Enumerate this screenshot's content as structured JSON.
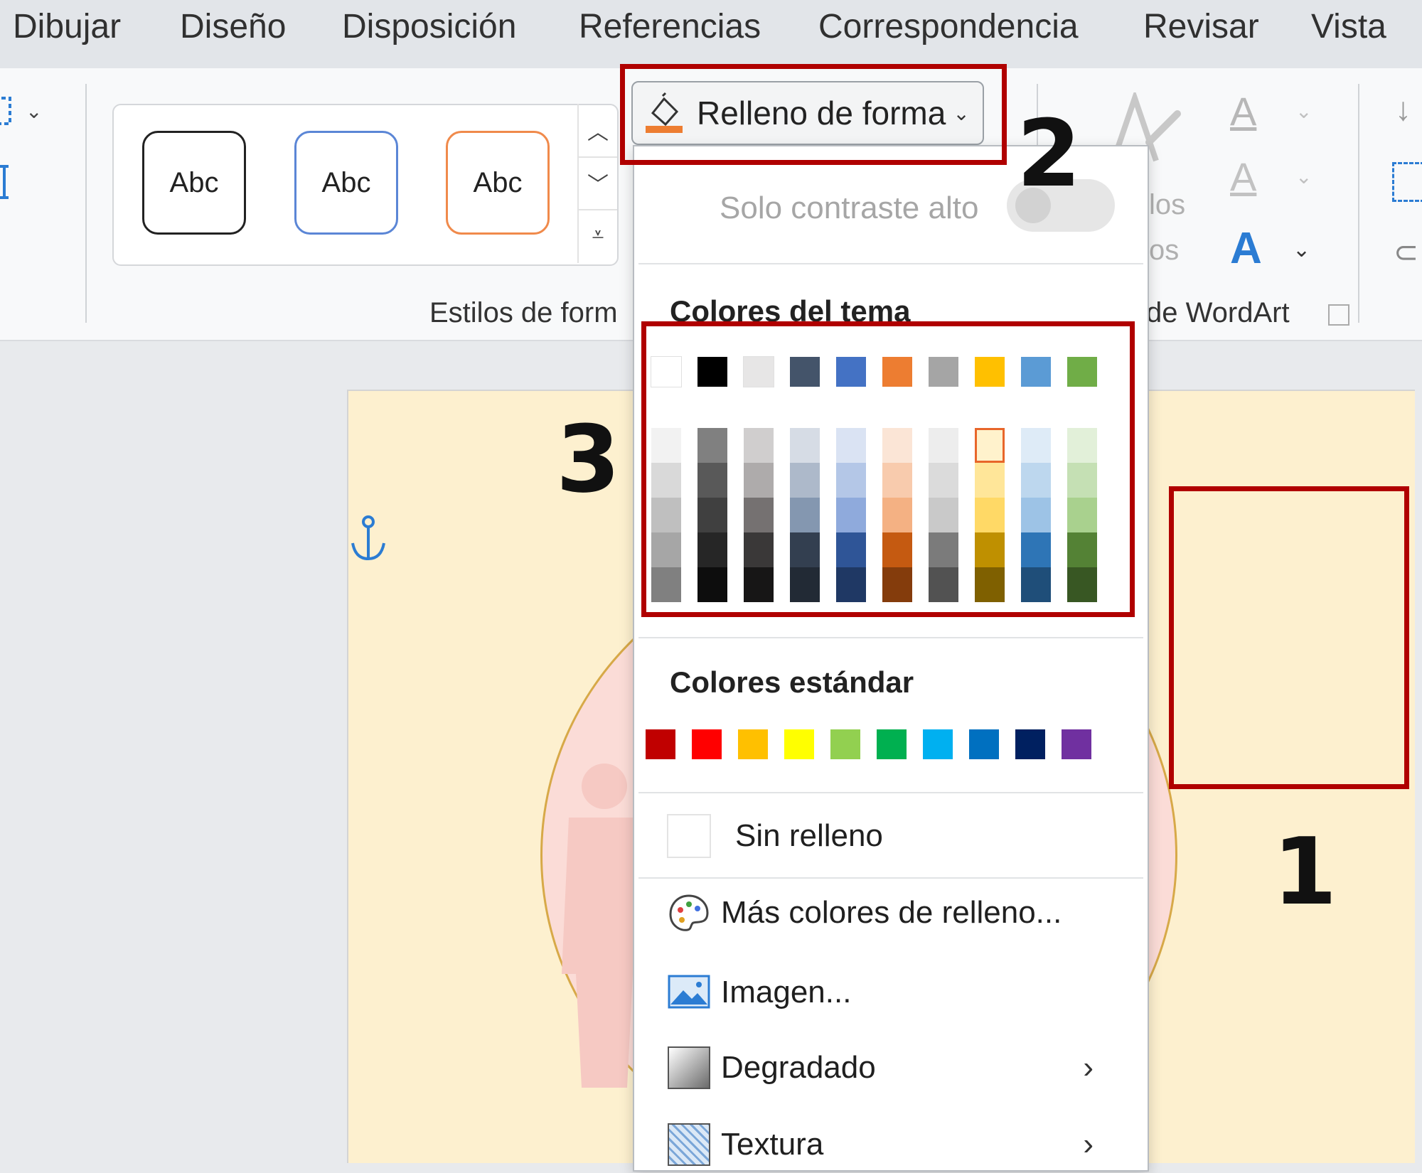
{
  "menu": {
    "tabs": [
      "Dibujar",
      "Diseño",
      "Disposición",
      "Referencias",
      "Correspondencia",
      "Revisar",
      "Vista"
    ]
  },
  "ribbon": {
    "style_preview_label": "Abc",
    "group_shape_styles": "Estilos de form",
    "group_wordart": "de WordArt",
    "partial_label_1": "los",
    "partial_label_2": "os",
    "shape_fill_button": "Relleno de forma",
    "shape_fill_color": "#ed7d31"
  },
  "dropdown": {
    "high_contrast_label": "Solo contraste alto",
    "high_contrast_on": false,
    "theme_colors_title": "Colores del tema",
    "theme_colors": [
      "#ffffff",
      "#000000",
      "#e7e6e6",
      "#44546a",
      "#4472c4",
      "#ed7d31",
      "#a5a5a5",
      "#ffc000",
      "#5b9bd5",
      "#70ad47"
    ],
    "theme_shades": [
      [
        "#f2f2f2",
        "#d9d9d9",
        "#bfbfbf",
        "#a6a6a6",
        "#808080"
      ],
      [
        "#808080",
        "#595959",
        "#404040",
        "#262626",
        "#0d0d0d"
      ],
      [
        "#d0cece",
        "#aeabab",
        "#757171",
        "#3a3838",
        "#171616"
      ],
      [
        "#d6dce5",
        "#adb9ca",
        "#8497b0",
        "#333f50",
        "#222a35"
      ],
      [
        "#dae3f3",
        "#b4c7e7",
        "#8faadc",
        "#2f5597",
        "#1f3864"
      ],
      [
        "#fbe5d6",
        "#f8cbad",
        "#f4b183",
        "#c55a11",
        "#843c0c"
      ],
      [
        "#ededed",
        "#dbdbdb",
        "#c9c9c9",
        "#7b7b7b",
        "#525252"
      ],
      [
        "#fff2cc",
        "#ffe699",
        "#ffd966",
        "#bf9000",
        "#7f6000"
      ],
      [
        "#deebf7",
        "#bdd7ee",
        "#9dc3e6",
        "#2e75b6",
        "#1f4e79"
      ],
      [
        "#e2f0d9",
        "#c5e0b4",
        "#a9d18e",
        "#548235",
        "#385723"
      ]
    ],
    "standard_colors_title": "Colores estándar",
    "standard_colors": [
      "#c00000",
      "#ff0000",
      "#ffc000",
      "#ffff00",
      "#92d050",
      "#00b050",
      "#00b0f0",
      "#0070c0",
      "#002060",
      "#7030a0"
    ],
    "no_fill": "Sin relleno",
    "more_colors": "Más colores de relleno...",
    "picture": "Imagen...",
    "gradient": "Degradado",
    "texture": "Textura"
  },
  "annotations": [
    "1",
    "2",
    "3"
  ],
  "annotation_color": "#b00000"
}
